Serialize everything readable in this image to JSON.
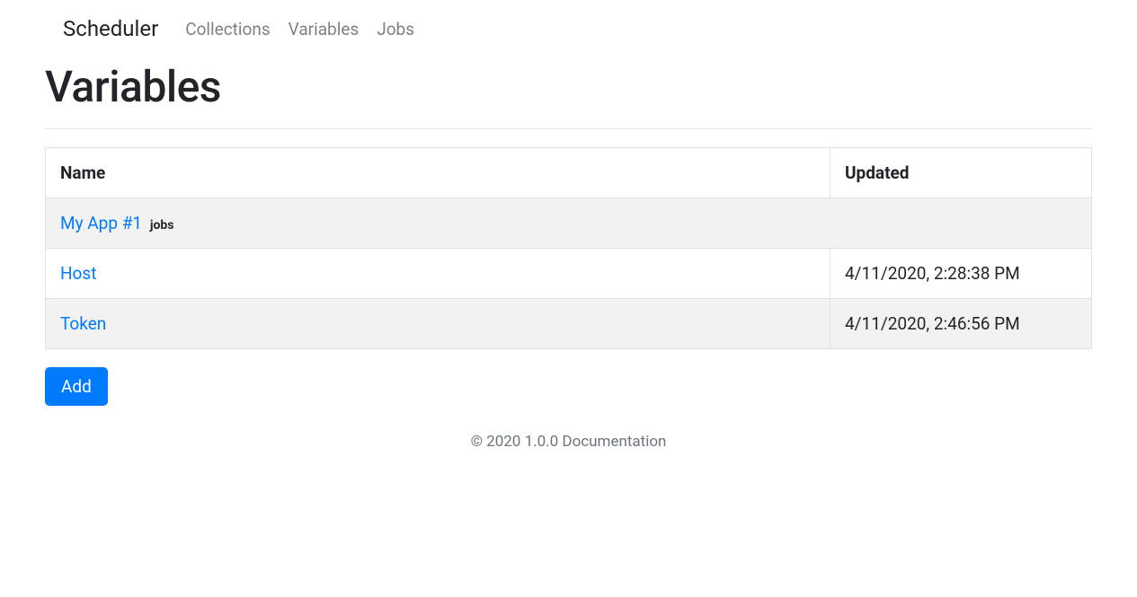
{
  "navbar": {
    "brand": "Scheduler",
    "links": [
      {
        "label": "Collections"
      },
      {
        "label": "Variables"
      },
      {
        "label": "Jobs"
      }
    ]
  },
  "page": {
    "title": "Variables"
  },
  "table": {
    "headers": {
      "name": "Name",
      "updated": "Updated"
    },
    "group": {
      "label": "My App #1",
      "badge": "jobs"
    },
    "rows": [
      {
        "name": "Host",
        "updated": "4/11/2020, 2:28:38 PM"
      },
      {
        "name": "Token",
        "updated": "4/11/2020, 2:46:56 PM"
      }
    ]
  },
  "buttons": {
    "add": "Add"
  },
  "footer": {
    "text": "© 2020 1.0.0 Documentation"
  }
}
